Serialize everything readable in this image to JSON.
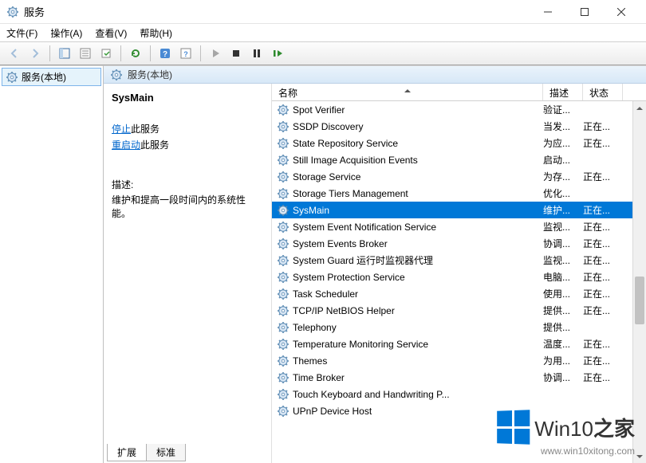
{
  "window": {
    "title": "服务"
  },
  "menu": {
    "file": "文件(F)",
    "action": "操作(A)",
    "view": "查看(V)",
    "help": "帮助(H)"
  },
  "tree": {
    "root": "服务(本地)"
  },
  "paneHeader": "服务(本地)",
  "detail": {
    "name": "SysMain",
    "stop": "停止",
    "stop_suffix": "此服务",
    "restart": "重启动",
    "restart_suffix": "此服务",
    "desc_label": "描述:",
    "desc": "维护和提高一段时间内的系统性能。"
  },
  "columns": {
    "name": "名称",
    "desc": "描述",
    "status": "状态"
  },
  "services": [
    {
      "name": "Spot Verifier",
      "desc": "验证...",
      "status": "",
      "sel": false
    },
    {
      "name": "SSDP Discovery",
      "desc": "当发...",
      "status": "正在...",
      "sel": false
    },
    {
      "name": "State Repository Service",
      "desc": "为应...",
      "status": "正在...",
      "sel": false
    },
    {
      "name": "Still Image Acquisition Events",
      "desc": "启动...",
      "status": "",
      "sel": false
    },
    {
      "name": "Storage Service",
      "desc": "为存...",
      "status": "正在...",
      "sel": false
    },
    {
      "name": "Storage Tiers Management",
      "desc": "优化...",
      "status": "",
      "sel": false
    },
    {
      "name": "SysMain",
      "desc": "维护...",
      "status": "正在...",
      "sel": true
    },
    {
      "name": "System Event Notification Service",
      "desc": "监视...",
      "status": "正在...",
      "sel": false
    },
    {
      "name": "System Events Broker",
      "desc": "协调...",
      "status": "正在...",
      "sel": false
    },
    {
      "name": "System Guard 运行时监视器代理",
      "desc": "监视...",
      "status": "正在...",
      "sel": false
    },
    {
      "name": "System Protection Service",
      "desc": "电脑...",
      "status": "正在...",
      "sel": false
    },
    {
      "name": "Task Scheduler",
      "desc": "使用...",
      "status": "正在...",
      "sel": false
    },
    {
      "name": "TCP/IP NetBIOS Helper",
      "desc": "提供...",
      "status": "正在...",
      "sel": false
    },
    {
      "name": "Telephony",
      "desc": "提供...",
      "status": "",
      "sel": false
    },
    {
      "name": "Temperature Monitoring Service",
      "desc": "温度...",
      "status": "正在...",
      "sel": false
    },
    {
      "name": "Themes",
      "desc": "为用...",
      "status": "正在...",
      "sel": false
    },
    {
      "name": "Time Broker",
      "desc": "协调...",
      "status": "正在...",
      "sel": false
    },
    {
      "name": "Touch Keyboard and Handwriting P...",
      "desc": "",
      "status": "",
      "sel": false
    },
    {
      "name": "UPnP Device Host",
      "desc": "",
      "status": "",
      "sel": false
    }
  ],
  "tabs": {
    "extended": "扩展",
    "standard": "标准"
  },
  "watermark": {
    "brand_a": "Win10",
    "brand_b": "之家",
    "url": "www.win10xitong.com"
  }
}
